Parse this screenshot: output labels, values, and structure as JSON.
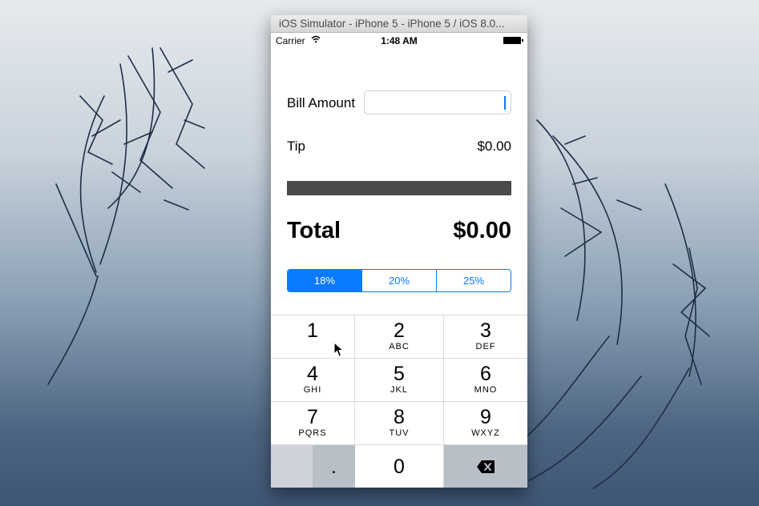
{
  "window": {
    "title": "iOS Simulator - iPhone 5 - iPhone 5 / iOS 8.0..."
  },
  "status_bar": {
    "carrier": "Carrier",
    "time": "1:48 AM"
  },
  "form": {
    "bill_label": "Bill Amount",
    "bill_value": "",
    "tip_label": "Tip",
    "tip_value": "$0.00",
    "total_label": "Total",
    "total_value": "$0.00"
  },
  "tip_options": [
    {
      "label": "18%",
      "selected": true
    },
    {
      "label": "20%",
      "selected": false
    },
    {
      "label": "25%",
      "selected": false
    }
  ],
  "keypad": {
    "keys": [
      {
        "digit": "1",
        "letters": ""
      },
      {
        "digit": "2",
        "letters": "ABC"
      },
      {
        "digit": "3",
        "letters": "DEF"
      },
      {
        "digit": "4",
        "letters": "GHI"
      },
      {
        "digit": "5",
        "letters": "JKL"
      },
      {
        "digit": "6",
        "letters": "MNO"
      },
      {
        "digit": "7",
        "letters": "PQRS"
      },
      {
        "digit": "8",
        "letters": "TUV"
      },
      {
        "digit": "9",
        "letters": "WXYZ"
      }
    ],
    "decimal": ".",
    "zero": "0",
    "delete_icon": "backspace-icon"
  },
  "colors": {
    "accent": "#0a7aff",
    "divider_bar": "#4a4a4a"
  }
}
